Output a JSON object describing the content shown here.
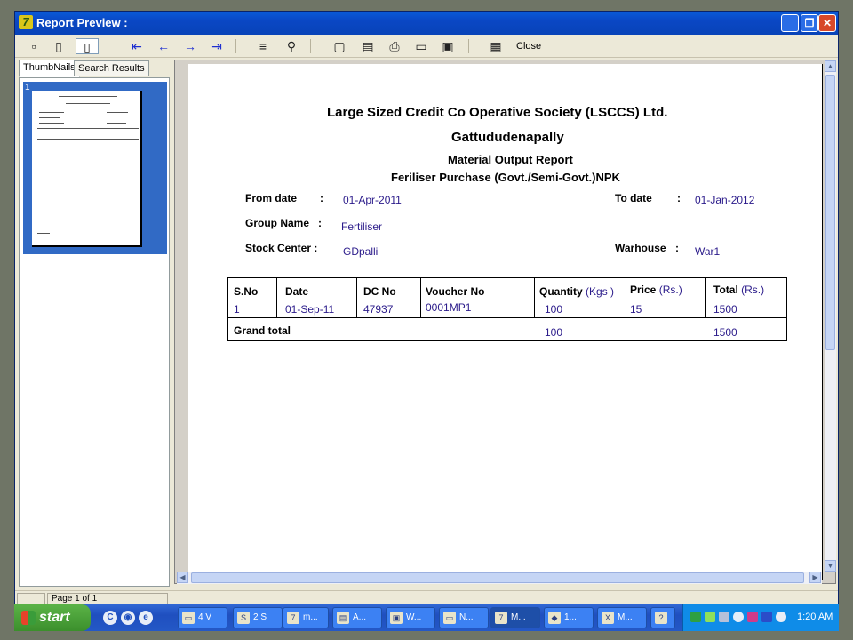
{
  "window": {
    "title": "Report Preview :"
  },
  "toolbar": {
    "close_label": "Close"
  },
  "tabs": [
    "ThumbNails",
    "Search Results"
  ],
  "thumbnail": {
    "number": "1"
  },
  "status": {
    "page_text": "Page 1 of 1"
  },
  "report": {
    "org": "Large Sized Credit Co Operative Society (LSCCS) Ltd.",
    "branch": "Gattududenapally",
    "title": "Material Output Report",
    "subtitle": "Feriliser Purchase (Govt./Semi-Govt.)NPK",
    "from_label": "From date",
    "from_value": "01-Apr-2011",
    "to_label": "To date",
    "to_value": "01-Jan-2012",
    "group_label": "Group Name",
    "group_value": "Fertiliser",
    "stock_label": "Stock Center :",
    "stock_value": "GDpalli",
    "warehouse_label": "Warhouse",
    "warehouse_value": "War1",
    "colon": ":",
    "columns": {
      "sno": "S.No",
      "date": "Date",
      "dc": "DC No",
      "voucher": "Voucher No",
      "qty": "Quantity",
      "qty_unit": "(Kgs )",
      "price": "Price",
      "price_unit": "(Rs.)",
      "total": "Total",
      "total_unit": "(Rs.)"
    },
    "row": {
      "sno": "1",
      "date": "01-Sep-11",
      "dc": "47937",
      "voucher": "0001MP1",
      "qty": "100",
      "price": "15",
      "total": "1500"
    },
    "grand": {
      "label": "Grand total",
      "qty": "100",
      "total": "1500"
    }
  },
  "taskbar": {
    "start_label": "start",
    "buttons": [
      "4 V",
      "2 S",
      "m...",
      "A...",
      "W...",
      "N...",
      "M...",
      "1...",
      "M..."
    ],
    "clock": "1:20 AM"
  }
}
